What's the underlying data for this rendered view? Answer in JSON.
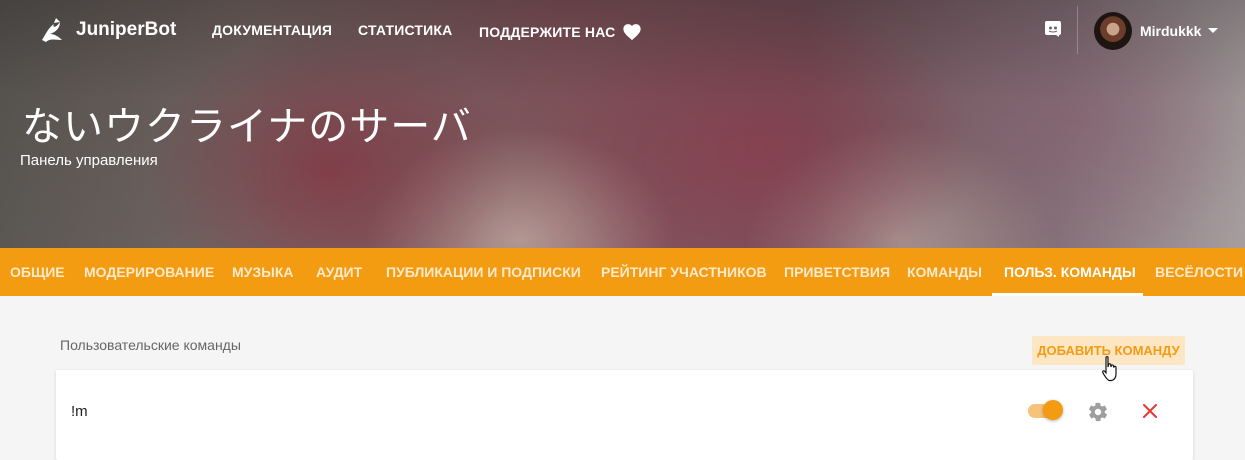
{
  "app": {
    "brand": "JuniperBot"
  },
  "topnav": {
    "links": [
      "ДОКУМЕНТАЦИЯ",
      "СТАТИСТИКА",
      "ПОДДЕРЖИТЕ НАС"
    ],
    "user": "Mirdukkk"
  },
  "server": {
    "title": "ないウクライナのサーバ",
    "subtitle": "Панель управления"
  },
  "tabs": [
    {
      "label": "ОБЩИЕ",
      "active": false
    },
    {
      "label": "МОДЕРИРОВАНИЕ",
      "active": false
    },
    {
      "label": "МУЗЫКА",
      "active": false
    },
    {
      "label": "АУДИТ",
      "active": false
    },
    {
      "label": "ПУБЛИКАЦИИ И ПОДПИСКИ",
      "active": false
    },
    {
      "label": "РЕЙТИНГ УЧАСТНИКОВ",
      "active": false
    },
    {
      "label": "ПРИВЕТСТВИЯ",
      "active": false
    },
    {
      "label": "КОМАНДЫ",
      "active": false
    },
    {
      "label": "ПОЛЬЗ. КОМАНДЫ",
      "active": true
    },
    {
      "label": "ВЕСЁЛОСТИ",
      "active": false
    }
  ],
  "commands": {
    "section_label": "Пользовательские команды",
    "add_label": "ДОБАВИТЬ КОМАНДУ",
    "items": [
      {
        "name": "!m",
        "enabled": true
      }
    ]
  },
  "colors": {
    "accent": "#f39c12",
    "danger": "#e53935"
  },
  "icons": {
    "logo": "juniper-logo-icon",
    "heart": "heart-icon",
    "discord": "discord-icon",
    "settings": "gear-icon",
    "delete": "close-icon",
    "menu": "caret-down-icon"
  }
}
